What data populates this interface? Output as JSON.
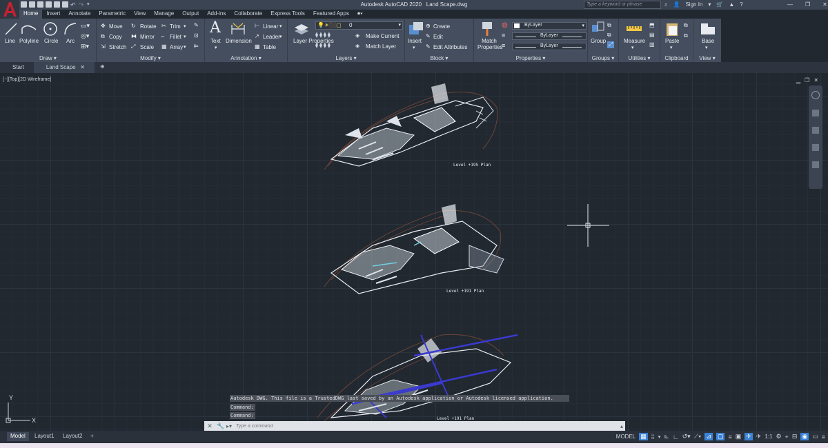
{
  "app": {
    "title": "Autodesk AutoCAD 2020",
    "file": "Land Scape.dwg",
    "logo": "A"
  },
  "search": {
    "placeholder": "Type a keyword or phrase"
  },
  "account": {
    "signin": "Sign In"
  },
  "ribbon_tabs": [
    "Home",
    "Insert",
    "Annotate",
    "Parametric",
    "View",
    "Manage",
    "Output",
    "Add-ins",
    "Collaborate",
    "Express Tools",
    "Featured Apps"
  ],
  "draw": {
    "title": "Draw",
    "line": "Line",
    "polyline": "Polyline",
    "circle": "Circle",
    "arc": "Arc"
  },
  "modify": {
    "title": "Modify",
    "move": "Move",
    "rotate": "Rotate",
    "trim": "Trim",
    "copy": "Copy",
    "mirror": "Mirror",
    "fillet": "Fillet",
    "stretch": "Stretch",
    "scale": "Scale",
    "array": "Array"
  },
  "annotation": {
    "title": "Annotation",
    "text": "Text",
    "dimension": "Dimension",
    "linear": "Linear",
    "leader": "Leader",
    "table": "Table"
  },
  "layers": {
    "title": "Layers",
    "layer_properties": "Layer Properties",
    "current_layer": "0",
    "make_current": "Make Current",
    "match_layer": "Match Layer"
  },
  "block": {
    "title": "Block",
    "insert": "Insert",
    "create": "Create",
    "edit": "Edit",
    "edit_attributes": "Edit Attributes"
  },
  "properties": {
    "title": "Properties",
    "match_properties": "Match Properties",
    "color": "ByLayer",
    "linetype": "ByLayer",
    "lineweight": "ByLayer"
  },
  "groups": {
    "title": "Groups",
    "group": "Group"
  },
  "utilities": {
    "title": "Utilities",
    "measure": "Measure"
  },
  "clipboard": {
    "title": "Clipboard",
    "paste": "Paste"
  },
  "view_panel": {
    "title": "View",
    "base": "Base"
  },
  "doc_tabs": [
    "Start",
    "Land Scape"
  ],
  "viewport": {
    "label": "[−][Top][2D Wireframe]"
  },
  "drawing_labels": [
    "Level +195 Plan",
    "Level +191 Plan",
    "Level +191 Plan"
  ],
  "ucs": {
    "x": "X",
    "y": "Y"
  },
  "command_history": [
    "Autodesk DWG.  This file is a TrustedDWG last saved by an Autodesk application or Autodesk licensed application.",
    "Command:",
    "Command:"
  ],
  "command": {
    "placeholder": "Type a command"
  },
  "layout_tabs": [
    "Model",
    "Layout1",
    "Layout2"
  ],
  "status": {
    "model": "MODEL",
    "scale": "1:1"
  },
  "colors": {
    "accent": "#3b82d6",
    "ribbon": "#444e5e",
    "viewport": "#212830",
    "autocad_red": "#c8202f"
  }
}
